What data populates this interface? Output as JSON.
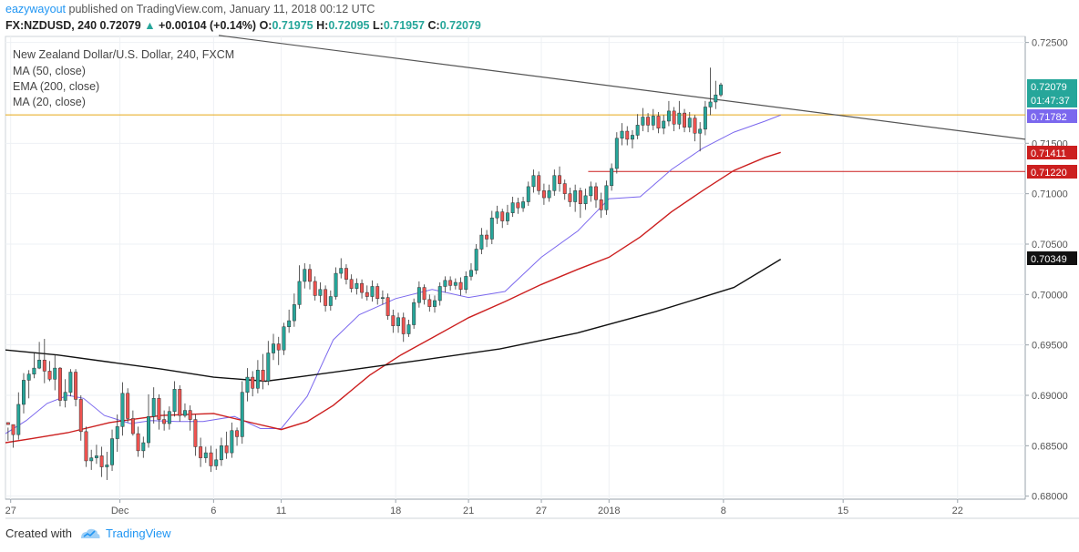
{
  "header": {
    "username": "eazywayout",
    "published_text": "published on TradingView.com, January 11, 2018 00:12 UTC",
    "symbol": "FX:NZDUSD, 240",
    "last": "0.72079",
    "change": "+0.00104 (+0.14%)",
    "o_label": "O:",
    "o": "0.71975",
    "h_label": "H:",
    "h": "0.72095",
    "l_label": "L:",
    "l": "0.71957",
    "c_label": "C:",
    "c": "0.72079"
  },
  "legend": {
    "instrument": "New Zealand Dollar/U.S. Dollar, 240, FXCM",
    "ma50": "MA (50, close)",
    "ema200": "EMA (200, close)",
    "ma20": "MA (20, close)"
  },
  "price_badges": {
    "last": "0.72079",
    "countdown": "01:47:37",
    "ma20": "0.71782",
    "ma50": "0.71411",
    "level": "0.71220",
    "ema200": "0.70349"
  },
  "footer": {
    "created_with": "Created with",
    "brand": "TradingView"
  },
  "colors": {
    "up": "#26a69a",
    "down": "#ef5350",
    "ma20": "#7b68ee",
    "ma50": "#cc1f1f",
    "ema200": "#111111",
    "trendline": "#555555",
    "hline_orange": "#e6a817",
    "hline_red": "#cc1f1f"
  },
  "chart_data": {
    "type": "candlestick",
    "timeframe": "240",
    "x_ticks": [
      "27",
      "Dec",
      "6",
      "11",
      "18",
      "21",
      "27",
      "2018",
      "8",
      "15",
      "22"
    ],
    "y_ticks": [
      "0.72500",
      "0.71500",
      "0.71000",
      "0.70500",
      "0.70000",
      "0.69500",
      "0.69000",
      "0.68500",
      "0.68000"
    ],
    "ylim": [
      0.6797,
      0.7256
    ],
    "x_index_range": [
      0,
      196
    ],
    "x_tick_index": [
      1,
      22,
      40,
      53,
      75,
      89,
      103,
      116,
      138,
      161,
      183
    ],
    "horizontal_levels": [
      0.71782,
      0.7122
    ],
    "trendline": {
      "from": [
        41,
        0.7257
      ],
      "to": [
        196,
        0.7154
      ]
    },
    "series": [
      {
        "name": "MA (20, close)",
        "key": "ma20",
        "points": [
          [
            0,
            0.6862
          ],
          [
            4,
            0.6875
          ],
          [
            8,
            0.6892
          ],
          [
            12,
            0.69
          ],
          [
            15,
            0.6897
          ],
          [
            19,
            0.688
          ],
          [
            24,
            0.6872
          ],
          [
            28,
            0.6875
          ],
          [
            33,
            0.6874
          ],
          [
            38,
            0.6874
          ],
          [
            44,
            0.6879
          ],
          [
            49,
            0.6867
          ],
          [
            53,
            0.6867
          ],
          [
            58,
            0.6899
          ],
          [
            63,
            0.6955
          ],
          [
            68,
            0.698
          ],
          [
            75,
            0.6996
          ],
          [
            82,
            0.7005
          ],
          [
            89,
            0.6997
          ],
          [
            96,
            0.7003
          ],
          [
            103,
            0.7037
          ],
          [
            110,
            0.7063
          ],
          [
            116,
            0.7095
          ],
          [
            122,
            0.7097
          ],
          [
            128,
            0.7124
          ],
          [
            134,
            0.7145
          ],
          [
            140,
            0.7161
          ],
          [
            146,
            0.7172
          ],
          [
            149,
            0.7178
          ]
        ]
      },
      {
        "name": "MA (50, close)",
        "key": "ma50",
        "points": [
          [
            0,
            0.6853
          ],
          [
            5,
            0.6857
          ],
          [
            12,
            0.6863
          ],
          [
            20,
            0.6873
          ],
          [
            30,
            0.688
          ],
          [
            40,
            0.6882
          ],
          [
            48,
            0.6872
          ],
          [
            53,
            0.6866
          ],
          [
            58,
            0.6874
          ],
          [
            63,
            0.689
          ],
          [
            70,
            0.692
          ],
          [
            76,
            0.694
          ],
          [
            82,
            0.6957
          ],
          [
            89,
            0.6977
          ],
          [
            96,
            0.6993
          ],
          [
            103,
            0.701
          ],
          [
            110,
            0.7025
          ],
          [
            116,
            0.7037
          ],
          [
            122,
            0.7057
          ],
          [
            128,
            0.7082
          ],
          [
            134,
            0.7103
          ],
          [
            140,
            0.7123
          ],
          [
            146,
            0.7136
          ],
          [
            149,
            0.7141
          ]
        ]
      },
      {
        "name": "EMA (200, close)",
        "key": "ema200",
        "points": [
          [
            0,
            0.6945
          ],
          [
            10,
            0.694
          ],
          [
            20,
            0.6933
          ],
          [
            30,
            0.6926
          ],
          [
            40,
            0.6918
          ],
          [
            50,
            0.6914
          ],
          [
            56,
            0.6918
          ],
          [
            66,
            0.6925
          ],
          [
            80,
            0.6935
          ],
          [
            95,
            0.6946
          ],
          [
            110,
            0.6962
          ],
          [
            125,
            0.6983
          ],
          [
            140,
            0.7007
          ],
          [
            149,
            0.7035
          ]
        ]
      }
    ],
    "candles": [
      [
        0.6873,
        0.6871,
        0.6868,
        0.6855
      ],
      [
        0.6871,
        0.6861,
        0.6861,
        0.6848
      ],
      [
        0.6861,
        0.6891,
        0.6903,
        0.6856
      ],
      [
        0.6891,
        0.6915,
        0.6922,
        0.6882
      ],
      [
        0.6915,
        0.6921,
        0.6925,
        0.6897
      ],
      [
        0.6921,
        0.6927,
        0.6942,
        0.6917
      ],
      [
        0.6927,
        0.6935,
        0.6953,
        0.6926
      ],
      [
        0.6935,
        0.6924,
        0.6956,
        0.6912
      ],
      [
        0.6924,
        0.6916,
        0.6934,
        0.6914
      ],
      [
        0.6916,
        0.6927,
        0.694,
        0.6905
      ],
      [
        0.6927,
        0.6895,
        0.6928,
        0.6889
      ],
      [
        0.6895,
        0.6903,
        0.6916,
        0.6888
      ],
      [
        0.6903,
        0.6923,
        0.6926,
        0.6899
      ],
      [
        0.6923,
        0.6896,
        0.6926,
        0.6889
      ],
      [
        0.6896,
        0.6864,
        0.69,
        0.6855
      ],
      [
        0.6864,
        0.6835,
        0.6869,
        0.6829
      ],
      [
        0.6835,
        0.6838,
        0.6846,
        0.6826
      ],
      [
        0.6838,
        0.684,
        0.6851,
        0.6832
      ],
      [
        0.684,
        0.6829,
        0.6849,
        0.6819
      ],
      [
        0.6829,
        0.6831,
        0.6844,
        0.6816
      ],
      [
        0.6831,
        0.6857,
        0.6866,
        0.6825
      ],
      [
        0.6857,
        0.6869,
        0.6881,
        0.6844
      ],
      [
        0.6869,
        0.6902,
        0.6913,
        0.686
      ],
      [
        0.6902,
        0.6877,
        0.6907,
        0.6873
      ],
      [
        0.6877,
        0.6862,
        0.6885,
        0.686
      ],
      [
        0.6862,
        0.6845,
        0.6869,
        0.6839
      ],
      [
        0.6845,
        0.6853,
        0.6859,
        0.6838
      ],
      [
        0.6853,
        0.6879,
        0.6901,
        0.6848
      ],
      [
        0.6879,
        0.6897,
        0.6908,
        0.6872
      ],
      [
        0.6897,
        0.6876,
        0.6901,
        0.6866
      ],
      [
        0.6876,
        0.6872,
        0.6885,
        0.6865
      ],
      [
        0.6872,
        0.6884,
        0.6889,
        0.6866
      ],
      [
        0.6884,
        0.6906,
        0.6914,
        0.6879
      ],
      [
        0.6906,
        0.688,
        0.691,
        0.6874
      ],
      [
        0.688,
        0.6885,
        0.6892,
        0.6878
      ],
      [
        0.6885,
        0.6876,
        0.689,
        0.6865
      ],
      [
        0.6876,
        0.6849,
        0.6881,
        0.684
      ],
      [
        0.6849,
        0.6838,
        0.6858,
        0.6829
      ],
      [
        0.6838,
        0.6843,
        0.6849,
        0.6833
      ],
      [
        0.6843,
        0.683,
        0.685,
        0.6824
      ],
      [
        0.683,
        0.6836,
        0.6847,
        0.6826
      ],
      [
        0.6836,
        0.685,
        0.6858,
        0.683
      ],
      [
        0.685,
        0.6843,
        0.6864,
        0.6837
      ],
      [
        0.6843,
        0.6865,
        0.6873,
        0.6838
      ],
      [
        0.6865,
        0.6859,
        0.6868,
        0.685
      ],
      [
        0.6859,
        0.6903,
        0.6914,
        0.6852
      ],
      [
        0.6903,
        0.6918,
        0.6927,
        0.6894
      ],
      [
        0.6918,
        0.6907,
        0.6924,
        0.6899
      ],
      [
        0.6907,
        0.6925,
        0.6935,
        0.6902
      ],
      [
        0.6925,
        0.6914,
        0.6941,
        0.6906
      ],
      [
        0.6914,
        0.6942,
        0.6954,
        0.691
      ],
      [
        0.6942,
        0.6951,
        0.6961,
        0.6935
      ],
      [
        0.6951,
        0.6945,
        0.6958,
        0.693
      ],
      [
        0.6945,
        0.6968,
        0.6972,
        0.694
      ],
      [
        0.6968,
        0.6974,
        0.6985,
        0.6962
      ],
      [
        0.6974,
        0.699,
        0.7001,
        0.6968
      ],
      [
        0.699,
        0.7013,
        0.7029,
        0.6986
      ],
      [
        0.7013,
        0.7025,
        0.7031,
        0.7006
      ],
      [
        0.7025,
        0.7013,
        0.703,
        0.7005
      ],
      [
        0.7013,
        0.6999,
        0.7018,
        0.6994
      ],
      [
        0.6999,
        0.7005,
        0.7012,
        0.6992
      ],
      [
        0.7005,
        0.6989,
        0.7009,
        0.6983
      ],
      [
        0.6989,
        0.6998,
        0.7004,
        0.6984
      ],
      [
        0.6998,
        0.7021,
        0.7027,
        0.6995
      ],
      [
        0.7021,
        0.7026,
        0.7036,
        0.7016
      ],
      [
        0.7026,
        0.7015,
        0.703,
        0.701
      ],
      [
        0.7015,
        0.7006,
        0.702,
        0.7002
      ],
      [
        0.7006,
        0.7011,
        0.7016,
        0.7
      ],
      [
        0.7011,
        0.7002,
        0.7015,
        0.6996
      ],
      [
        0.7002,
        0.6998,
        0.7009,
        0.6994
      ],
      [
        0.6998,
        0.7008,
        0.7014,
        0.6993
      ],
      [
        0.7008,
        0.6996,
        0.7011,
        0.699
      ],
      [
        0.6996,
        0.6997,
        0.7004,
        0.699
      ],
      [
        0.6997,
        0.6979,
        0.7001,
        0.6975
      ],
      [
        0.6979,
        0.6969,
        0.6985,
        0.6962
      ],
      [
        0.6969,
        0.6977,
        0.6982,
        0.6962
      ],
      [
        0.6977,
        0.6961,
        0.6982,
        0.6953
      ],
      [
        0.6961,
        0.697,
        0.6975,
        0.6958
      ],
      [
        0.697,
        0.6992,
        0.6996,
        0.6966
      ],
      [
        0.6992,
        0.7007,
        0.7013,
        0.6987
      ],
      [
        0.7007,
        0.6995,
        0.701,
        0.699
      ],
      [
        0.6995,
        0.6988,
        0.7,
        0.6983
      ],
      [
        0.6988,
        0.6994,
        0.6999,
        0.6982
      ],
      [
        0.6994,
        0.7008,
        0.7012,
        0.6989
      ],
      [
        0.7008,
        0.7014,
        0.7018,
        0.7002
      ],
      [
        0.7014,
        0.7009,
        0.7018,
        0.7004
      ],
      [
        0.7009,
        0.7012,
        0.7016,
        0.7005
      ],
      [
        0.7012,
        0.7005,
        0.7017,
        0.6999
      ],
      [
        0.7005,
        0.7018,
        0.7023,
        0.7001
      ],
      [
        0.7018,
        0.7024,
        0.7031,
        0.7014
      ],
      [
        0.7024,
        0.7045,
        0.705,
        0.702
      ],
      [
        0.7045,
        0.7059,
        0.7066,
        0.704
      ],
      [
        0.7059,
        0.7055,
        0.7064,
        0.7047
      ],
      [
        0.7055,
        0.7076,
        0.7083,
        0.705
      ],
      [
        0.7076,
        0.7082,
        0.7088,
        0.707
      ],
      [
        0.7082,
        0.7073,
        0.7085,
        0.7066
      ],
      [
        0.7073,
        0.7081,
        0.7089,
        0.7069
      ],
      [
        0.7081,
        0.7091,
        0.7097,
        0.7077
      ],
      [
        0.7091,
        0.7086,
        0.7096,
        0.708
      ],
      [
        0.7086,
        0.7092,
        0.7097,
        0.7082
      ],
      [
        0.7092,
        0.7107,
        0.7112,
        0.7088
      ],
      [
        0.7107,
        0.7118,
        0.7124,
        0.7101
      ],
      [
        0.7118,
        0.7103,
        0.7122,
        0.7099
      ],
      [
        0.7103,
        0.7096,
        0.711,
        0.7089
      ],
      [
        0.7096,
        0.7103,
        0.7109,
        0.7092
      ],
      [
        0.7103,
        0.7118,
        0.7124,
        0.7098
      ],
      [
        0.7118,
        0.711,
        0.7127,
        0.7102
      ],
      [
        0.711,
        0.71,
        0.7114,
        0.7094
      ],
      [
        0.71,
        0.7092,
        0.7106,
        0.7087
      ],
      [
        0.7092,
        0.7103,
        0.7109,
        0.7082
      ],
      [
        0.7103,
        0.709,
        0.7106,
        0.7076
      ],
      [
        0.709,
        0.7098,
        0.7105,
        0.7084
      ],
      [
        0.7098,
        0.7107,
        0.7112,
        0.7092
      ],
      [
        0.7107,
        0.7094,
        0.7111,
        0.7086
      ],
      [
        0.7094,
        0.7084,
        0.7101,
        0.7076
      ],
      [
        0.7084,
        0.7108,
        0.7113,
        0.7079
      ],
      [
        0.7108,
        0.7125,
        0.713,
        0.7103
      ],
      [
        0.7125,
        0.7155,
        0.7161,
        0.712
      ],
      [
        0.7155,
        0.7162,
        0.717,
        0.7148
      ],
      [
        0.7162,
        0.7154,
        0.7167,
        0.7148
      ],
      [
        0.7154,
        0.7158,
        0.7163,
        0.7145
      ],
      [
        0.7158,
        0.7168,
        0.7179,
        0.7154
      ],
      [
        0.7168,
        0.7176,
        0.7185,
        0.7162
      ],
      [
        0.7176,
        0.7168,
        0.718,
        0.7161
      ],
      [
        0.7168,
        0.7177,
        0.7184,
        0.7163
      ],
      [
        0.7177,
        0.7165,
        0.7181,
        0.716
      ],
      [
        0.7165,
        0.7172,
        0.7178,
        0.7159
      ],
      [
        0.7172,
        0.7182,
        0.7192,
        0.7167
      ],
      [
        0.7182,
        0.7169,
        0.7186,
        0.7162
      ],
      [
        0.7169,
        0.718,
        0.7192,
        0.7164
      ],
      [
        0.718,
        0.7166,
        0.7184,
        0.7161
      ],
      [
        0.7166,
        0.7175,
        0.7181,
        0.7161
      ],
      [
        0.7175,
        0.716,
        0.7178,
        0.7152
      ],
      [
        0.716,
        0.7164,
        0.7171,
        0.7142
      ],
      [
        0.7164,
        0.7186,
        0.7192,
        0.7158
      ],
      [
        0.7186,
        0.7191,
        0.7225,
        0.7178
      ],
      [
        0.7191,
        0.7198,
        0.7212,
        0.7184
      ],
      [
        0.7198,
        0.7208,
        0.721,
        0.7196
      ]
    ]
  }
}
